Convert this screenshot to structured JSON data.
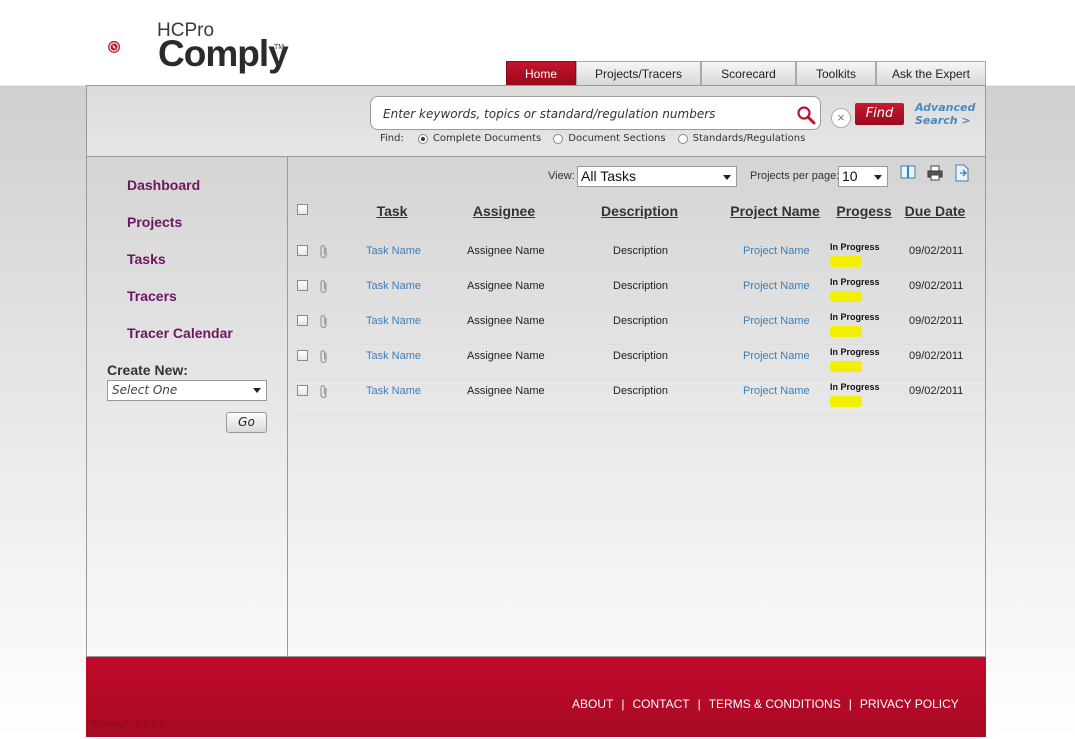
{
  "brand": {
    "hc": "HC",
    "pro": "Pro",
    "name": "Comply",
    "tm": "TM"
  },
  "nav": {
    "tabs": [
      "Home",
      "Projects/Tracers",
      "Scorecard",
      "Toolkits",
      "Ask the Expert"
    ],
    "active": "Home"
  },
  "search": {
    "placeholder": "Enter keywords, topics or standard/regulation numbers",
    "find_label": "Find",
    "advanced_line1": "Advanced",
    "advanced_line2": "Search >",
    "find_prefix": "Find:",
    "options": [
      "Complete Documents",
      "Document Sections",
      "Standards/Regulations"
    ],
    "selected_option": "Complete Documents"
  },
  "sidebar": {
    "items": [
      "Dashboard",
      "Projects",
      "Tasks",
      "Tracers",
      "Tracer Calendar"
    ],
    "create_new_label": "Create New:",
    "create_new_value": "Select One",
    "go_label": "Go"
  },
  "controls": {
    "view_label": "View:",
    "view_value": "All Tasks",
    "per_page_label": "Projects per page:",
    "per_page_value": "10"
  },
  "icons": [
    "book-icon",
    "print-icon",
    "export-icon",
    "search-icon",
    "clear-icon",
    "paperclip-icon"
  ],
  "table": {
    "headers": [
      "Task",
      "Assignee",
      "Description",
      "Project Name",
      "Progess",
      "Due Date"
    ],
    "rows": [
      {
        "task": "Task Name",
        "assignee": "Assignee Name",
        "description": "Description",
        "project": "Project Name",
        "progress": "In Progress",
        "due": "09/02/2011"
      },
      {
        "task": "Task Name",
        "assignee": "Assignee Name",
        "description": "Description",
        "project": "Project Name",
        "progress": "In Progress",
        "due": "09/02/2011"
      },
      {
        "task": "Task Name",
        "assignee": "Assignee Name",
        "description": "Description",
        "project": "Project Name",
        "progress": "In Progress",
        "due": "09/02/2011"
      },
      {
        "task": "Task Name",
        "assignee": "Assignee Name",
        "description": "Description",
        "project": "Project Name",
        "progress": "In Progress",
        "due": "09/02/2011"
      },
      {
        "task": "Task Name",
        "assignee": "Assignee Name",
        "description": "Description",
        "project": "Project Name",
        "progress": "In Progress",
        "due": "09/02/2011"
      }
    ]
  },
  "footer": {
    "links": [
      "ABOUT",
      "CONTACT",
      "TERMS & CONDITIONS",
      "PRIVACY POLICY"
    ],
    "revision": "Revision: 1.0.0.0"
  },
  "colors": {
    "brand_red": "#b5101f",
    "sidebar_link": "#6d1560",
    "link_blue": "#3b7fb8",
    "progress_highlight": "#f2f000"
  }
}
